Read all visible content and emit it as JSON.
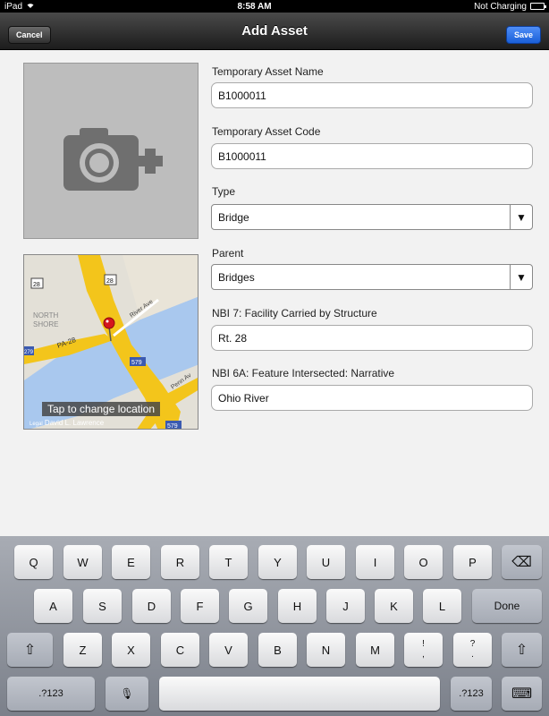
{
  "status_bar": {
    "device": "iPad",
    "wifi_icon": "wifi-icon",
    "time": "8:58 AM",
    "charging": "Not Charging",
    "battery_icon": "battery-icon"
  },
  "nav": {
    "title": "Add Asset",
    "cancel_label": "Cancel",
    "save_label": "Save"
  },
  "photo": {
    "icon": "camera-add-icon"
  },
  "map": {
    "caption": "Tap to change location",
    "legal": "Legal",
    "attribution": "David L. Lawrence",
    "labels": [
      "NORTH",
      "SHORE",
      "River Ave",
      "PA-28",
      "Penn Av"
    ],
    "shields": [
      "28",
      "28",
      "279",
      "579",
      "579"
    ]
  },
  "form": {
    "fields": [
      {
        "label": "Temporary Asset Name",
        "value": "B1000011"
      },
      {
        "label": "Temporary Asset Code",
        "value": "B1000011"
      },
      {
        "label": "Type",
        "value": "Bridge"
      },
      {
        "label": "Parent",
        "value": "Bridges"
      },
      {
        "label": "NBI 7: Facility Carried by Structure",
        "value": "Rt. 28"
      },
      {
        "label": "NBI 6A: Feature Intersected: Narrative",
        "value": "Ohio River"
      }
    ],
    "dropdown_arrow": "▼"
  },
  "keyboard": {
    "row1": [
      "Q",
      "W",
      "E",
      "R",
      "T",
      "Y",
      "U",
      "I",
      "O",
      "P"
    ],
    "row2": [
      "A",
      "S",
      "D",
      "F",
      "G",
      "H",
      "J",
      "K",
      "L"
    ],
    "row3": [
      "Z",
      "X",
      "C",
      "V",
      "B",
      "N",
      "M"
    ],
    "done_label": "Done",
    "numbers_label": ".?123",
    "exclaim_top": "!",
    "exclaim_bottom": ",",
    "question_top": "?",
    "question_bottom": ".",
    "shift_glyph": "⇧",
    "backspace_glyph": "⌫",
    "mic_glyph": "🎙",
    "keyboard_glyph": "⌨"
  }
}
